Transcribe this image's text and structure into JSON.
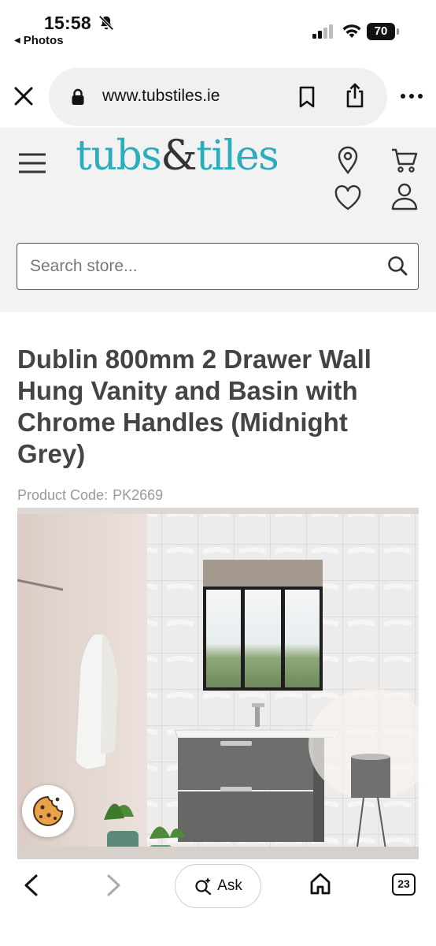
{
  "status_bar": {
    "time": "15:58",
    "back_app": "Photos",
    "battery": "70"
  },
  "browser": {
    "url": "www.tubstiles.ie",
    "ask_label": "Ask",
    "tab_count": "23"
  },
  "site": {
    "logo_part1": "tubs",
    "logo_amp": "&",
    "logo_part2": "tiles",
    "search_placeholder": "Search store..."
  },
  "product": {
    "title": "Dublin 800mm 2 Drawer Wall Hung Vanity and Basin with Chrome Handles (Midnight Grey)",
    "code_label": "Product Code:",
    "code_value": "PK2669"
  },
  "colors": {
    "brand_teal": "#2aaebb",
    "brand_dark": "#333333",
    "title_grey": "#444444",
    "header_bg": "#f2f2f2"
  },
  "icons": {
    "close": "close-icon",
    "lock": "lock-icon",
    "bookmark": "bookmark-icon",
    "share": "share-icon",
    "more": "more-icon",
    "menu": "hamburger-icon",
    "location": "map-pin-icon",
    "cart": "cart-icon",
    "wishlist": "heart-icon",
    "account": "user-icon",
    "search": "search-icon",
    "cookie": "cookie-icon",
    "back": "chevron-left-icon",
    "forward": "chevron-right-icon",
    "ask": "sparkle-search-icon",
    "home": "home-icon"
  }
}
